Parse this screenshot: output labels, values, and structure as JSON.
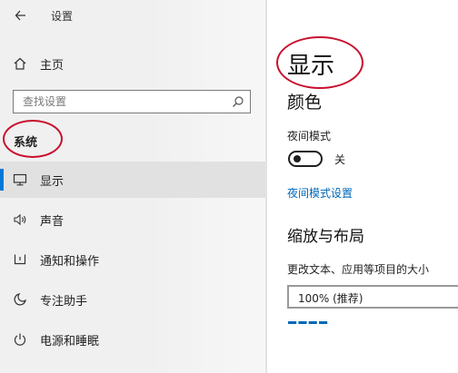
{
  "window": {
    "title": "设置"
  },
  "sidebar": {
    "home_label": "主页",
    "search_placeholder": "查找设置",
    "section_label": "系统",
    "items": [
      {
        "label": "显示",
        "icon": "monitor-icon",
        "selected": true
      },
      {
        "label": "声音",
        "icon": "speaker-icon",
        "selected": false
      },
      {
        "label": "通知和操作",
        "icon": "notification-icon",
        "selected": false
      },
      {
        "label": "专注助手",
        "icon": "moon-icon",
        "selected": false
      },
      {
        "label": "电源和睡眠",
        "icon": "power-icon",
        "selected": false
      }
    ]
  },
  "main": {
    "page_title": "显示",
    "color_heading": "颜色",
    "night_mode_label": "夜间模式",
    "night_mode_state": "关",
    "night_mode_link": "夜间模式设置",
    "scale_heading": "缩放与布局",
    "scale_label": "更改文本、应用等项目的大小",
    "scale_value": "100% (推荐)"
  },
  "colors": {
    "accent": "#0078d7",
    "link": "#0067b8",
    "annotation": "#c8102e"
  }
}
